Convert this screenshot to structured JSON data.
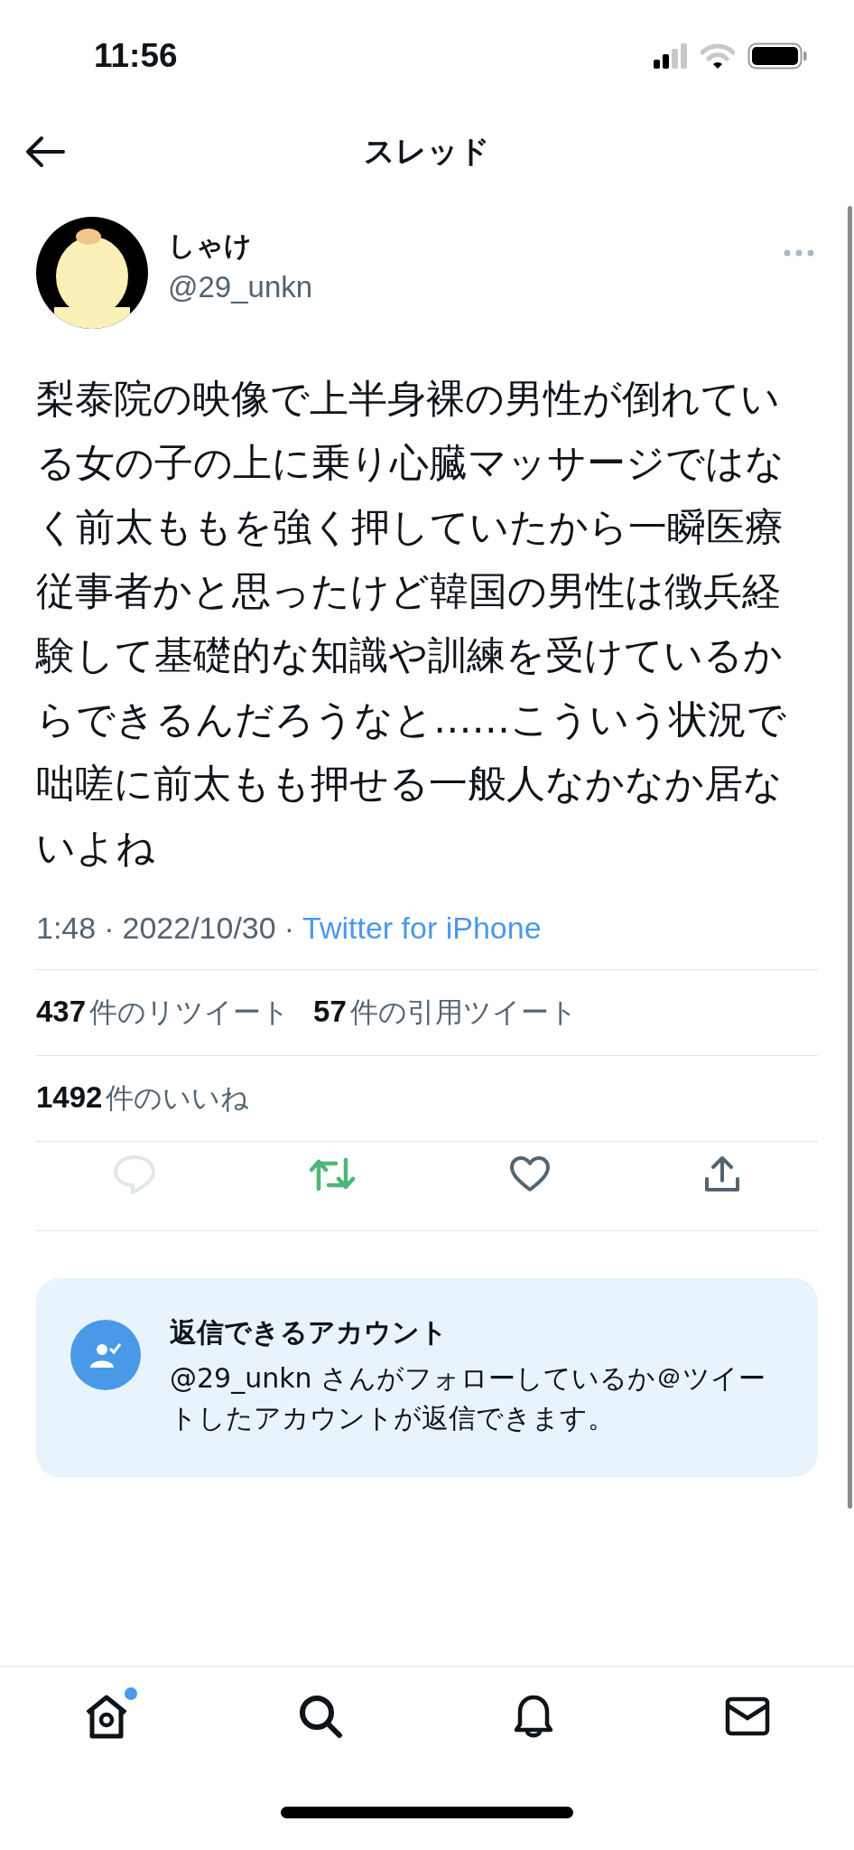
{
  "status_bar": {
    "time": "11:56"
  },
  "header": {
    "title": "スレッド"
  },
  "tweet": {
    "name": "しゃけ",
    "handle": "@29_unkn",
    "text": "梨泰院の映像で上半身裸の男性が倒れている女の子の上に乗り心臓マッサージではなく前太ももを強く押していたから一瞬医療従事者かと思ったけど韓国の男性は徴兵経験して基礎的な知識や訓練を受けているからできるんだろうなと……こういう状況で咄嗟に前太もも押せる一般人なかなか居ないよね",
    "time": "1:48",
    "date": "2022/10/30",
    "separator": "·",
    "source": "Twitter for iPhone",
    "stats": [
      {
        "count": "437",
        "label": "件のリツイート"
      },
      {
        "count": "57",
        "label": "件の引用ツイート"
      }
    ],
    "likes": {
      "count": "1492",
      "label": "件のいいね"
    },
    "actions": [
      {
        "kind": "reply",
        "disabled": true
      },
      {
        "kind": "retweet",
        "on": true
      },
      {
        "kind": "like",
        "on": false
      },
      {
        "kind": "share"
      }
    ]
  },
  "reply_notice": {
    "title": "返信できるアカウント",
    "text": "@29_unkn さんがフォローしているか＠ツイートしたアカウントが返信できます。"
  },
  "tab_bar": [
    {
      "kind": "home",
      "badge": true
    },
    {
      "kind": "search",
      "badge": false
    },
    {
      "kind": "notifications",
      "badge": false
    },
    {
      "kind": "messages",
      "badge": false
    }
  ]
}
